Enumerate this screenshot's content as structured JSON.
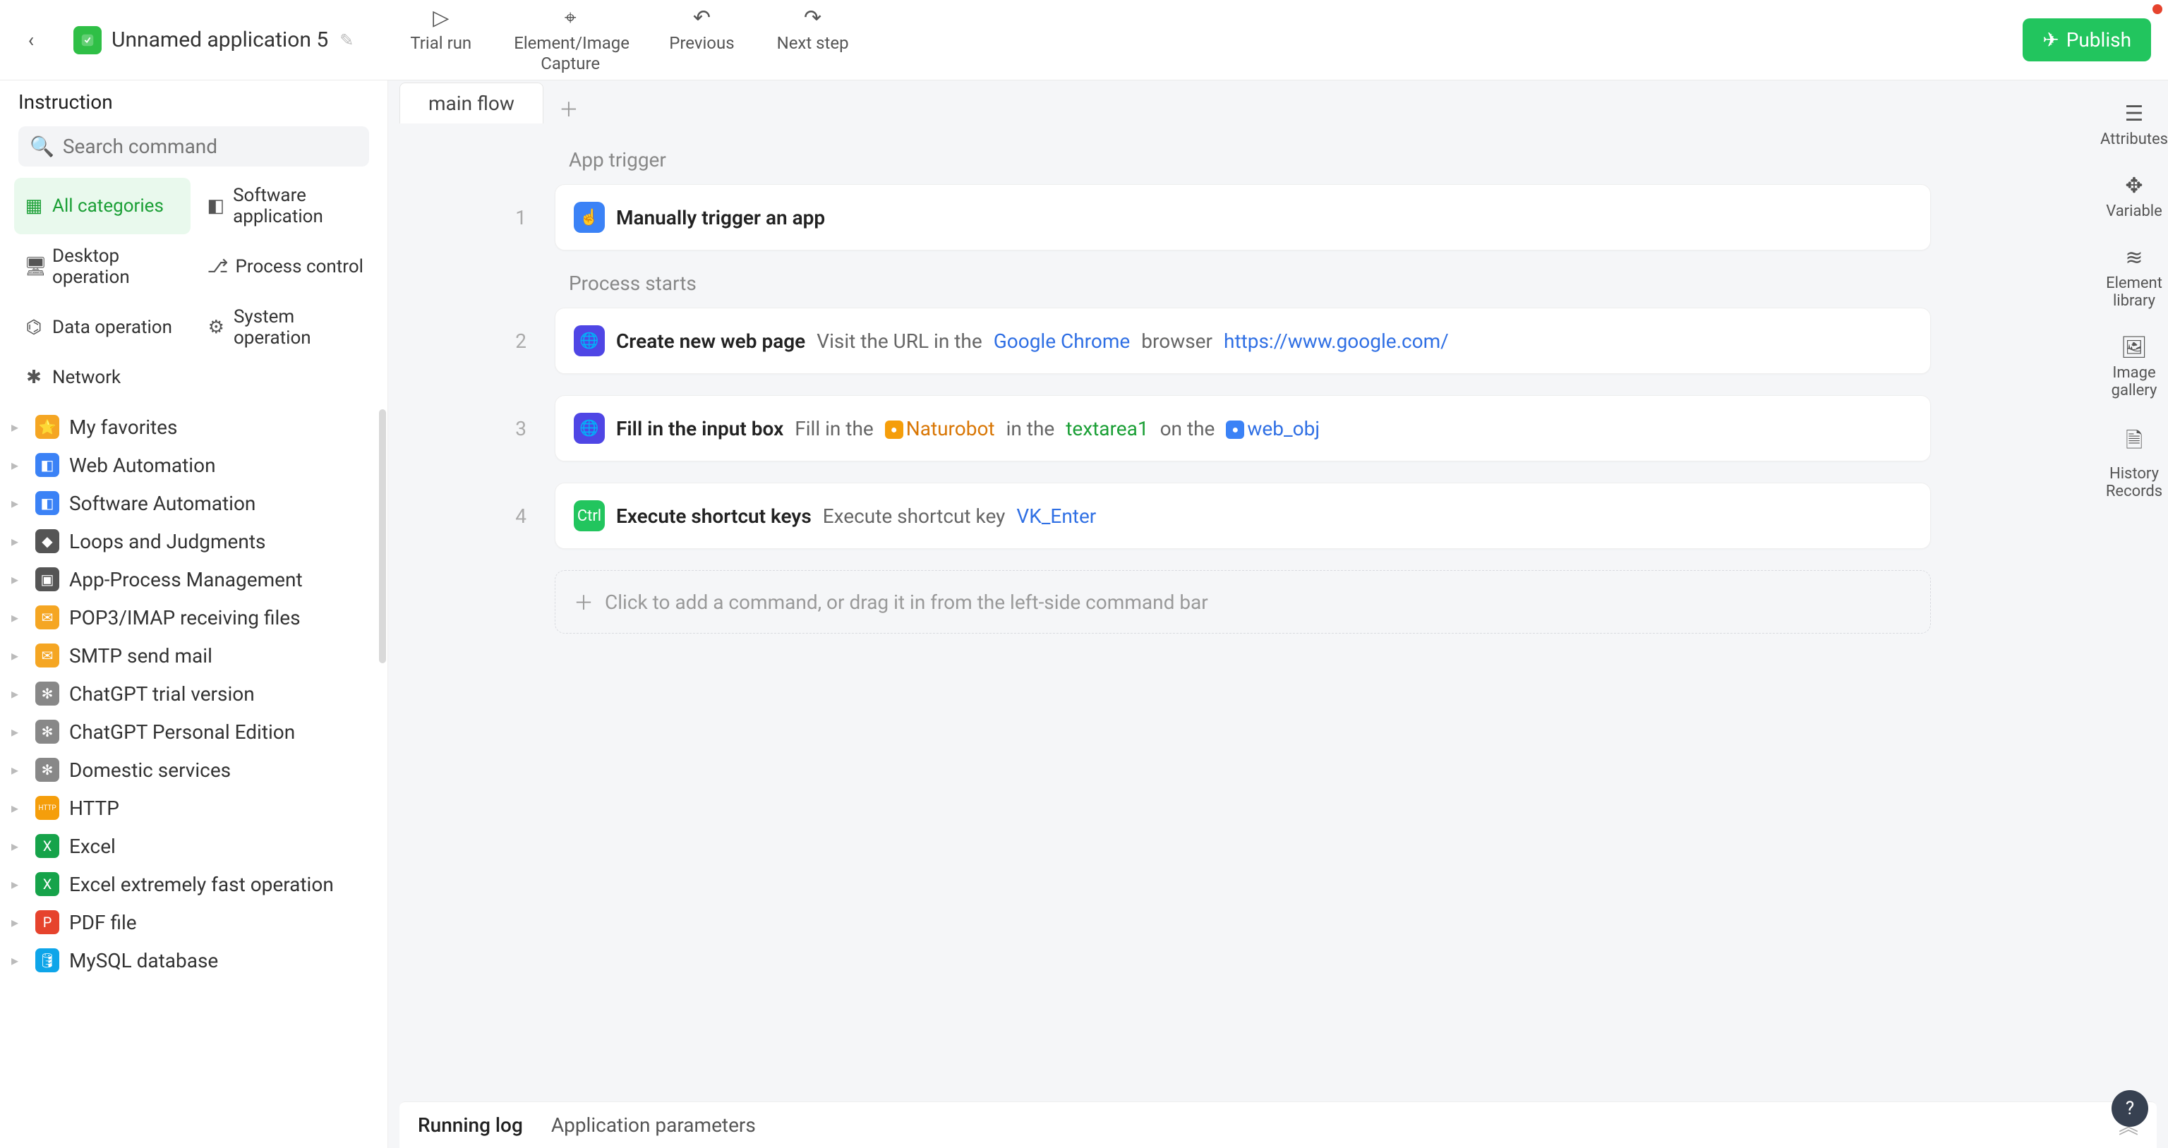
{
  "header": {
    "app_title": "Unnamed application 5",
    "tools": {
      "trial_run": "Trial run",
      "capture": "Element/Image Capture",
      "previous": "Previous",
      "next": "Next step"
    },
    "publish": "Publish"
  },
  "sidebar": {
    "title": "Instruction",
    "search_placeholder": "Search command",
    "categories": {
      "all": "All categories",
      "software": "Software application",
      "desktop": "Desktop operation",
      "process": "Process control",
      "data": "Data operation",
      "system": "System operation",
      "network": "Network"
    },
    "tree": [
      {
        "label": "My favorites",
        "icon": "⭐",
        "color": "#f5a623"
      },
      {
        "label": "Web Automation",
        "icon": "◧",
        "color": "#3b82f6"
      },
      {
        "label": "Software Automation",
        "icon": "◧",
        "color": "#3b82f6"
      },
      {
        "label": "Loops and Judgments",
        "icon": "◆",
        "color": "#555"
      },
      {
        "label": "App-Process Management",
        "icon": "▣",
        "color": "#555"
      },
      {
        "label": "POP3/IMAP receiving files",
        "icon": "✉",
        "color": "#f5a623"
      },
      {
        "label": "SMTP send mail",
        "icon": "✉",
        "color": "#f5a623"
      },
      {
        "label": "ChatGPT trial version",
        "icon": "✻",
        "color": "#888"
      },
      {
        "label": "ChatGPT Personal Edition",
        "icon": "✻",
        "color": "#888"
      },
      {
        "label": "Domestic services",
        "icon": "✻",
        "color": "#888"
      },
      {
        "label": "HTTP",
        "icon": "HTTP",
        "color": "#f59e0b"
      },
      {
        "label": "Excel",
        "icon": "X",
        "color": "#16a34a"
      },
      {
        "label": "Excel extremely fast operation",
        "icon": "X",
        "color": "#16a34a"
      },
      {
        "label": "PDF file",
        "icon": "P",
        "color": "#e6432d"
      },
      {
        "label": "MySQL database",
        "icon": "🛢",
        "color": "#0ea5e9"
      }
    ]
  },
  "flow": {
    "tab": "main flow",
    "trigger_label": "App trigger",
    "process_label": "Process starts",
    "steps": [
      {
        "n": "1",
        "title": "Manually trigger an app",
        "icon": "☝",
        "ic": "ic-blue",
        "parts": []
      },
      {
        "n": "2",
        "title": "Create new web page",
        "icon": "🌐",
        "ic": "ic-bluep",
        "parts": [
          {
            "t": "Visit the URL in the",
            "cls": "muted"
          },
          {
            "t": "Google Chrome",
            "cls": "link-blue"
          },
          {
            "t": "browser",
            "cls": "muted"
          },
          {
            "t": "https://www.google.com/",
            "cls": "link-blue"
          }
        ]
      },
      {
        "n": "3",
        "title": "Fill in the input box",
        "icon": "🌐",
        "ic": "ic-bluep",
        "parts": [
          {
            "t": "Fill in the",
            "cls": "muted"
          },
          {
            "badge": "mb-o",
            "t": "Naturobot",
            "cls": "orange-chip"
          },
          {
            "t": "in the",
            "cls": "muted"
          },
          {
            "t": "textarea1",
            "cls": "green-chip"
          },
          {
            "t": "on the",
            "cls": "muted"
          },
          {
            "badge": "mb-b",
            "t": "web_obj",
            "cls": "link-blue"
          }
        ]
      },
      {
        "n": "4",
        "title": "Execute shortcut keys",
        "icon": "Ctrl",
        "ic": "ic-green",
        "parts": [
          {
            "t": "Execute shortcut key",
            "cls": "muted"
          },
          {
            "t": "VK_Enter",
            "cls": "link-blue"
          }
        ]
      }
    ],
    "add_hint": "Click to add a command, or drag it in from the left-side command bar"
  },
  "rail": {
    "attributes": "Attributes",
    "variable": "Variable",
    "element": "Element library",
    "image": "Image gallery",
    "history": "History Records"
  },
  "bottom": {
    "running_log": "Running log",
    "app_params": "Application parameters"
  }
}
